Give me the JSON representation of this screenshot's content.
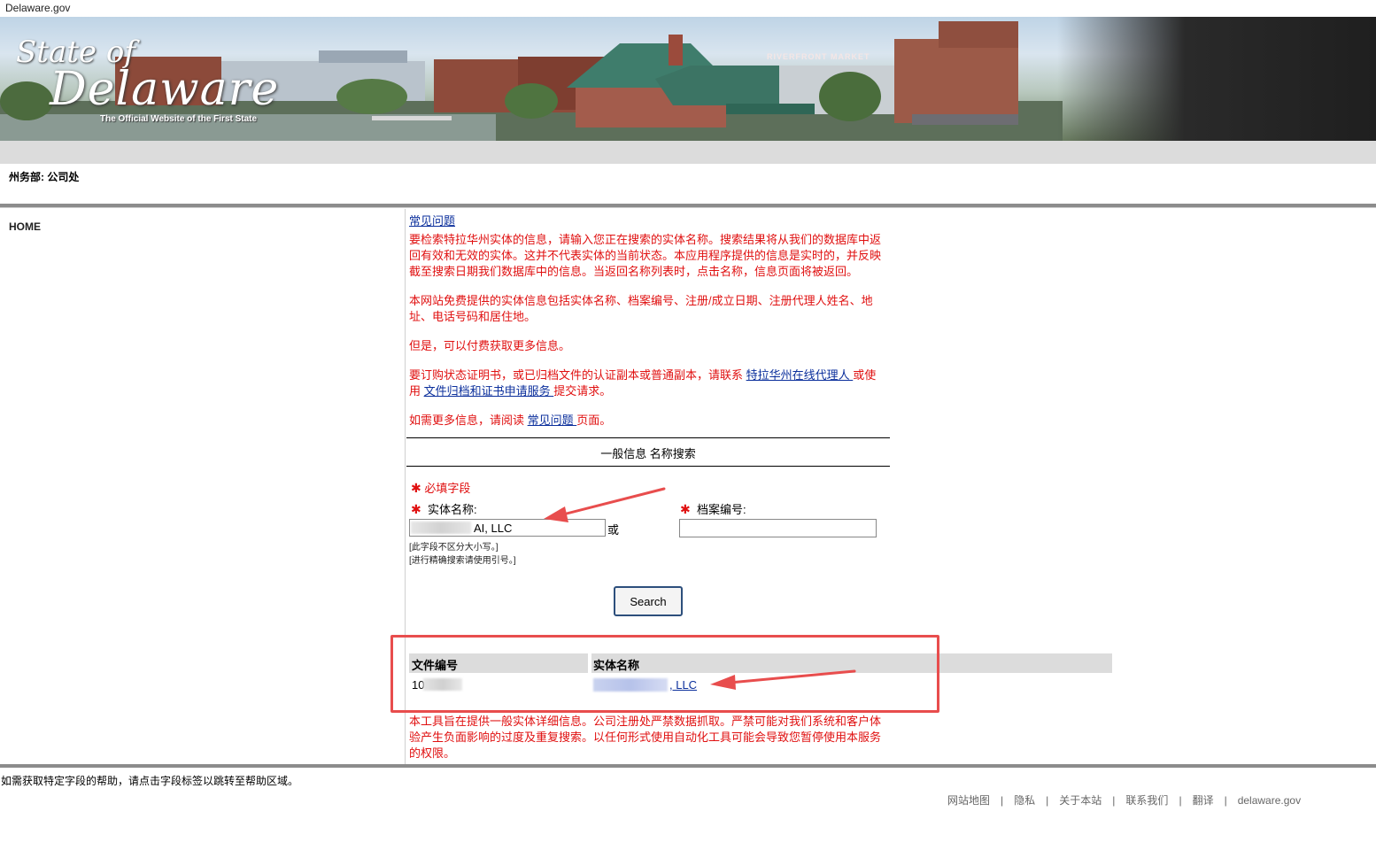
{
  "top_bar": {
    "site": "Delaware.gov"
  },
  "banner": {
    "logo_state": "State of",
    "logo_delaware": "Delaware",
    "logo_tagline": "The Official Website of the First State",
    "market_sign": "RIVERFRONT MARKET"
  },
  "department": "州务部: 公司处",
  "left_nav": {
    "home": "HOME"
  },
  "intro": {
    "faq_link": "常见问题",
    "p1": "要检索特拉华州实体的信息，请输入您正在搜索的实体名称。搜索结果将从我们的数据库中返回有效和无效的实体。这并不代表实体的当前状态。本应用程序提供的信息是实时的，并反映截至搜索日期我们数据库中的信息。当返回名称列表时，点击名称，信息页面将被返回。",
    "p2": "本网站免费提供的实体信息包括实体名称、档案编号、注册/成立日期、注册代理人姓名、地址、电话号码和居住地。",
    "p3": "但是，可以付费获取更多信息。",
    "p4_before": "要订购状态证明书，或已归档文件的认证副本或普通副本，请联系 ",
    "p4_link1": "特拉华州在线代理人 ",
    "p4_middle": "或使用 ",
    "p4_link2": "文件归档和证书申请服务 ",
    "p4_after": "提交请求。",
    "p5_before": "如需更多信息，请阅读 ",
    "p5_link": "常见问题 ",
    "p5_after": "页面。"
  },
  "search_form": {
    "section_title": "一般信息 名称搜索",
    "required_label": "必填字段",
    "entity_name_label": "实体名称:",
    "entity_name_value": "AI, LLC",
    "or_label": "或",
    "file_number_label": "档案编号:",
    "file_number_value": "",
    "hint_case": "[此字段不区分大小写。]",
    "hint_quotes": "[进行精确搜索请使用引号。]",
    "search_button": "Search"
  },
  "results": {
    "col_file_number": "文件编号",
    "col_entity_name": "实体名称",
    "rows": [
      {
        "file_number": "10",
        "entity_name": ", LLC"
      }
    ]
  },
  "disclaimer": "本工具旨在提供一般实体详细信息。公司注册处严禁数据抓取。严禁可能对我们系统和客户体验产生负面影响的过度及重复搜索。以任何形式使用自动化工具可能会导致您暂停使用本服务的权限。",
  "help_text": "如需获取特定字段的帮助，请点击字段标签以跳转至帮助区域。",
  "footer": {
    "links": [
      "网站地图",
      "隐私",
      "关于本站",
      "联系我们",
      "翻译",
      "delaware.gov"
    ],
    "separator": "|"
  },
  "colors": {
    "red_text": "#e01010",
    "link": "#0b2f9c",
    "annotation": "#e84d4d",
    "table_header_bg": "#dcdcdc"
  }
}
